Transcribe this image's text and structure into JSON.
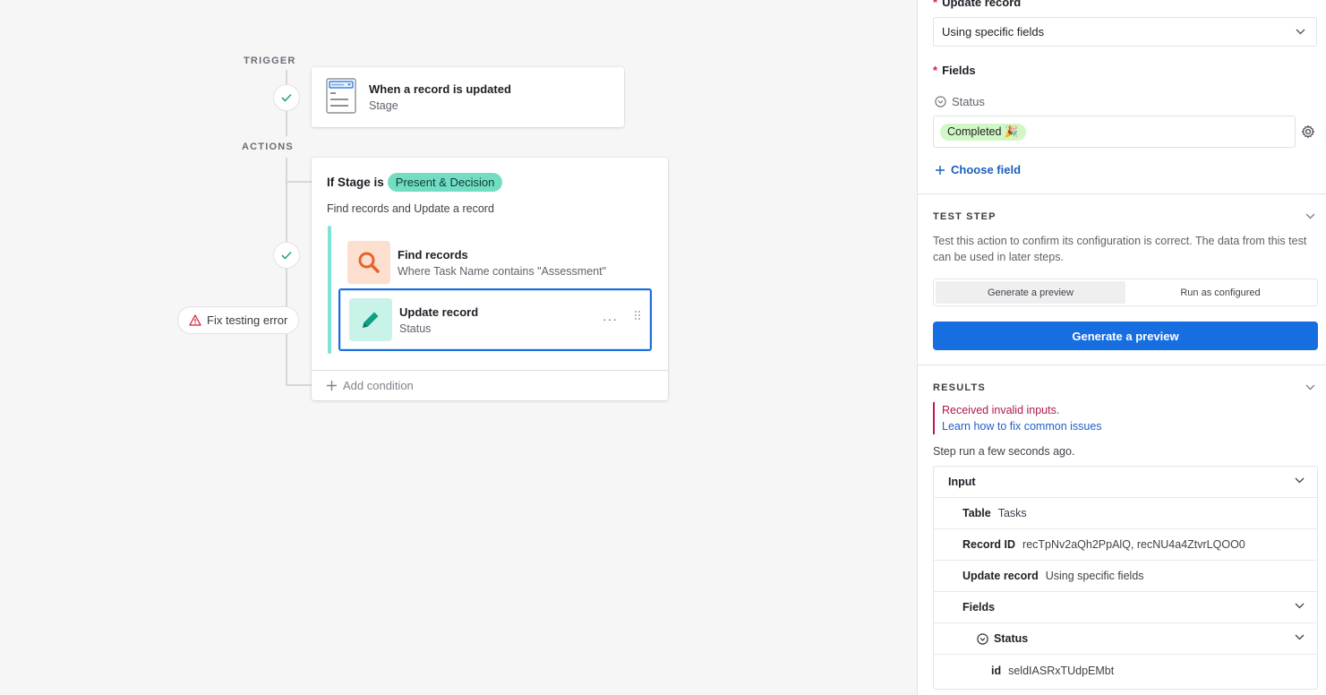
{
  "canvas": {
    "trigger_label": "TRIGGER",
    "actions_label": "ACTIONS",
    "trigger_card": {
      "title": "When a record is updated",
      "subtitle": "Stage"
    },
    "condition": {
      "prefix": "If Stage is",
      "value": "Present & Decision",
      "description": "Find records and Update a record",
      "steps": [
        {
          "title": "Find records",
          "subtitle": "Where Task Name contains \"Assessment\""
        },
        {
          "title": "Update record",
          "subtitle": "Status",
          "menu": "···"
        }
      ],
      "add_condition": "Add condition"
    },
    "fix_error": "Fix testing error"
  },
  "panel": {
    "update_record_label": "Update record",
    "update_record_value": "Using specific fields",
    "fields_label": "Fields",
    "status_field_label": "Status",
    "status_value": "Completed 🎉",
    "choose_field": "Choose field",
    "test_step": {
      "heading": "TEST STEP",
      "description": "Test this action to confirm its configuration is correct. The data from this test can be used in later steps.",
      "tab_preview": "Generate a preview",
      "tab_configured": "Run as configured",
      "button": "Generate a preview"
    },
    "results": {
      "heading": "RESULTS",
      "error": "Received invalid inputs.",
      "link": "Learn how to fix common issues",
      "run_time": "Step run a few seconds ago.",
      "input_label": "Input",
      "rows": [
        {
          "key": "Table",
          "value": "Tasks"
        },
        {
          "key": "Record ID",
          "value": "recTpNv2aQh2PpAlQ, recNU4a4ZtvrLQOO0"
        },
        {
          "key": "Update record",
          "value": "Using specific fields"
        }
      ],
      "fields_label": "Fields",
      "status_label": "Status",
      "id_key": "id",
      "id_value": "seldIASRxTUdpEMbt"
    }
  },
  "colors": {
    "accent": "#166ee1",
    "teal": "#72ddc3",
    "error": "#b0184f",
    "success": "#2aa876"
  }
}
